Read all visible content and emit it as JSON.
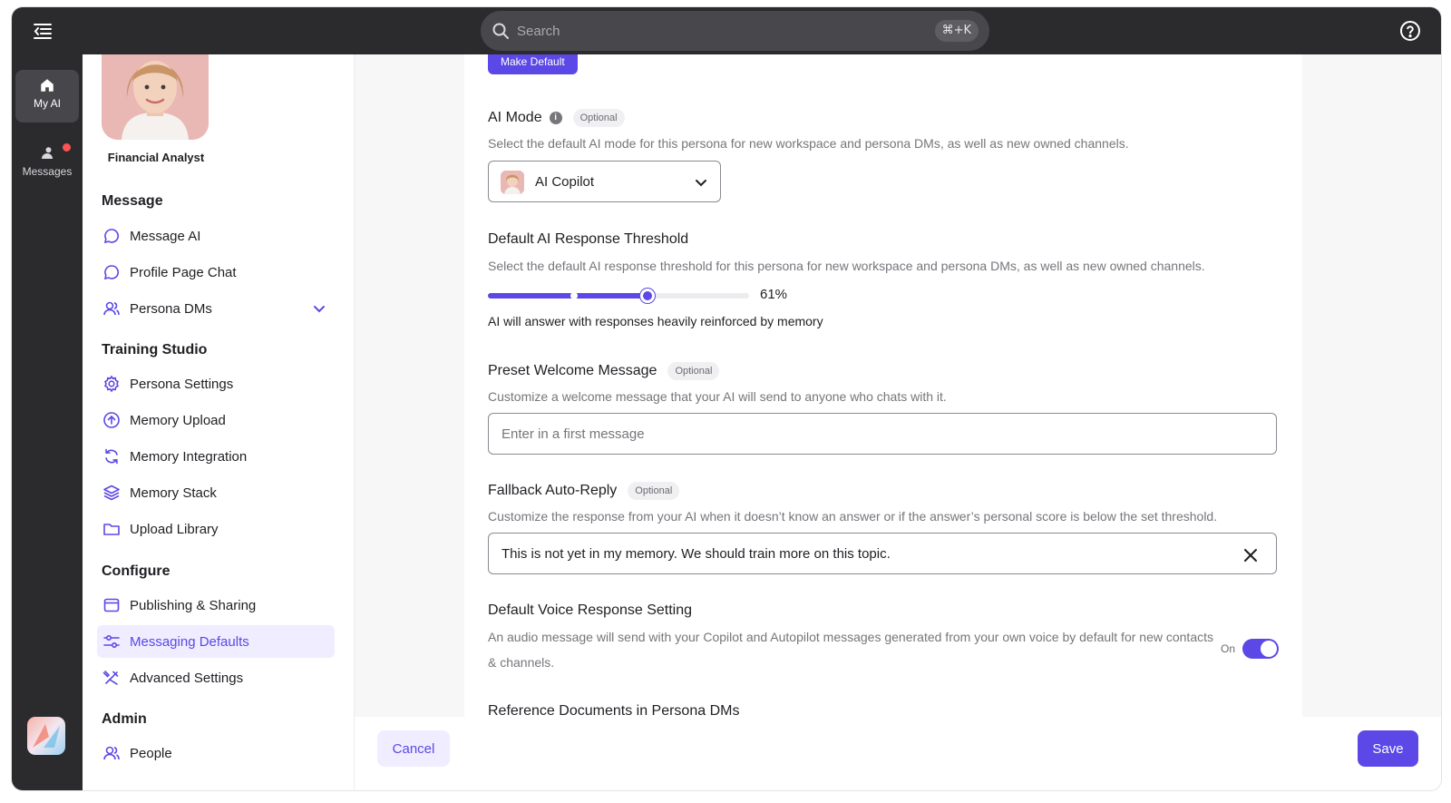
{
  "topbar": {
    "search_placeholder": "Search",
    "shortcut": "⌘+K"
  },
  "rail": {
    "items": [
      {
        "label": "My AI",
        "icon": "home-icon",
        "active": true
      },
      {
        "label": "Messages",
        "icon": "messages-icon",
        "has_notification": true
      }
    ],
    "notification_color": "#ff5252"
  },
  "sidebar": {
    "persona_name": "Financial Analyst",
    "sections": [
      {
        "title": "Message",
        "items": [
          {
            "label": "Message AI",
            "icon": "chat-bubble-icon"
          },
          {
            "label": "Profile Page Chat",
            "icon": "chat-bubble-icon"
          },
          {
            "label": "Persona DMs",
            "icon": "users-icon",
            "expandable": true
          }
        ]
      },
      {
        "title": "Training Studio",
        "items": [
          {
            "label": "Persona Settings",
            "icon": "gear-icon"
          },
          {
            "label": "Memory Upload",
            "icon": "upload-icon"
          },
          {
            "label": "Memory Integration",
            "icon": "sync-icon"
          },
          {
            "label": "Memory Stack",
            "icon": "layers-icon"
          },
          {
            "label": "Upload Library",
            "icon": "folder-icon"
          }
        ]
      },
      {
        "title": "Configure",
        "items": [
          {
            "label": "Publishing & Sharing",
            "icon": "window-icon"
          },
          {
            "label": "Messaging Defaults",
            "icon": "sliders-icon",
            "active": true
          },
          {
            "label": "Advanced Settings",
            "icon": "tools-icon"
          }
        ]
      },
      {
        "title": "Admin",
        "items": [
          {
            "label": "People",
            "icon": "user-icon"
          }
        ]
      }
    ]
  },
  "main": {
    "make_default_label": "Make Default",
    "ai_mode": {
      "label": "AI Mode",
      "badge": "Optional",
      "description": "Select the default AI mode for this persona for new workspace and persona DMs, as well as new owned channels.",
      "selected": "AI Copilot"
    },
    "threshold": {
      "label": "Default AI Response Threshold",
      "description": "Select the default AI response threshold for this persona for new workspace and persona DMs, as well as new owned channels.",
      "value": 61,
      "value_text": "61%",
      "marker_value": 33,
      "helper": "AI will answer with responses heavily reinforced by memory"
    },
    "welcome": {
      "label": "Preset Welcome Message",
      "badge": "Optional",
      "description": "Customize a welcome message that your AI will send to anyone who chats with it.",
      "placeholder": "Enter in a first message",
      "value": ""
    },
    "fallback": {
      "label": "Fallback Auto-Reply",
      "badge": "Optional",
      "description": "Customize the response from your AI when it doesn’t know an answer or if the answer’s personal score is below the set threshold.",
      "value": "This is not yet in my memory. We should train more on this topic."
    },
    "voice": {
      "label": "Default Voice Response Setting",
      "description": "An audio message will send with your Copilot and Autopilot messages generated from your own voice by default for new contacts & channels.",
      "toggle_label": "On",
      "enabled": true
    },
    "reference_docs": {
      "label": "Reference Documents in Persona DMs"
    }
  },
  "footer": {
    "cancel_label": "Cancel",
    "save_label": "Save"
  },
  "colors": {
    "accent": "#5b48e6",
    "accent_light": "#efedff",
    "dark_bar": "#2b2b2e"
  }
}
